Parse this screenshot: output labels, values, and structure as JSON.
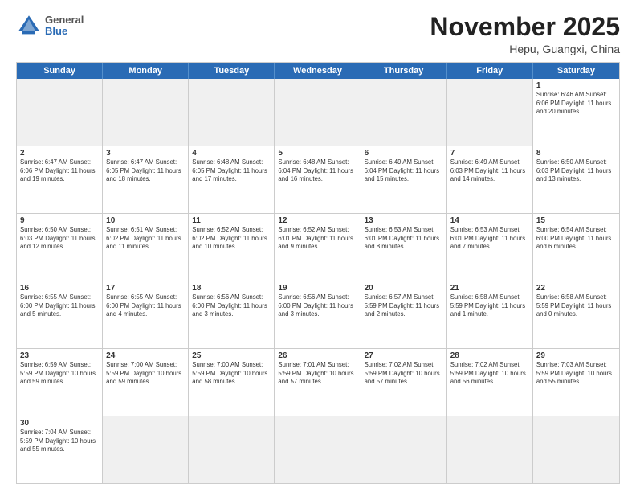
{
  "header": {
    "logo_general": "General",
    "logo_blue": "Blue",
    "month_title": "November 2025",
    "location": "Hepu, Guangxi, China"
  },
  "day_headers": [
    "Sunday",
    "Monday",
    "Tuesday",
    "Wednesday",
    "Thursday",
    "Friday",
    "Saturday"
  ],
  "weeks": [
    [
      {
        "num": "",
        "info": "",
        "empty": true
      },
      {
        "num": "",
        "info": "",
        "empty": true
      },
      {
        "num": "",
        "info": "",
        "empty": true
      },
      {
        "num": "",
        "info": "",
        "empty": true
      },
      {
        "num": "",
        "info": "",
        "empty": true
      },
      {
        "num": "",
        "info": "",
        "empty": true
      },
      {
        "num": "1",
        "info": "Sunrise: 6:46 AM\nSunset: 6:06 PM\nDaylight: 11 hours and 20 minutes.",
        "empty": false
      }
    ],
    [
      {
        "num": "2",
        "info": "Sunrise: 6:47 AM\nSunset: 6:06 PM\nDaylight: 11 hours and 19 minutes.",
        "empty": false
      },
      {
        "num": "3",
        "info": "Sunrise: 6:47 AM\nSunset: 6:05 PM\nDaylight: 11 hours and 18 minutes.",
        "empty": false
      },
      {
        "num": "4",
        "info": "Sunrise: 6:48 AM\nSunset: 6:05 PM\nDaylight: 11 hours and 17 minutes.",
        "empty": false
      },
      {
        "num": "5",
        "info": "Sunrise: 6:48 AM\nSunset: 6:04 PM\nDaylight: 11 hours and 16 minutes.",
        "empty": false
      },
      {
        "num": "6",
        "info": "Sunrise: 6:49 AM\nSunset: 6:04 PM\nDaylight: 11 hours and 15 minutes.",
        "empty": false
      },
      {
        "num": "7",
        "info": "Sunrise: 6:49 AM\nSunset: 6:03 PM\nDaylight: 11 hours and 14 minutes.",
        "empty": false
      },
      {
        "num": "8",
        "info": "Sunrise: 6:50 AM\nSunset: 6:03 PM\nDaylight: 11 hours and 13 minutes.",
        "empty": false
      }
    ],
    [
      {
        "num": "9",
        "info": "Sunrise: 6:50 AM\nSunset: 6:03 PM\nDaylight: 11 hours and 12 minutes.",
        "empty": false
      },
      {
        "num": "10",
        "info": "Sunrise: 6:51 AM\nSunset: 6:02 PM\nDaylight: 11 hours and 11 minutes.",
        "empty": false
      },
      {
        "num": "11",
        "info": "Sunrise: 6:52 AM\nSunset: 6:02 PM\nDaylight: 11 hours and 10 minutes.",
        "empty": false
      },
      {
        "num": "12",
        "info": "Sunrise: 6:52 AM\nSunset: 6:01 PM\nDaylight: 11 hours and 9 minutes.",
        "empty": false
      },
      {
        "num": "13",
        "info": "Sunrise: 6:53 AM\nSunset: 6:01 PM\nDaylight: 11 hours and 8 minutes.",
        "empty": false
      },
      {
        "num": "14",
        "info": "Sunrise: 6:53 AM\nSunset: 6:01 PM\nDaylight: 11 hours and 7 minutes.",
        "empty": false
      },
      {
        "num": "15",
        "info": "Sunrise: 6:54 AM\nSunset: 6:00 PM\nDaylight: 11 hours and 6 minutes.",
        "empty": false
      }
    ],
    [
      {
        "num": "16",
        "info": "Sunrise: 6:55 AM\nSunset: 6:00 PM\nDaylight: 11 hours and 5 minutes.",
        "empty": false
      },
      {
        "num": "17",
        "info": "Sunrise: 6:55 AM\nSunset: 6:00 PM\nDaylight: 11 hours and 4 minutes.",
        "empty": false
      },
      {
        "num": "18",
        "info": "Sunrise: 6:56 AM\nSunset: 6:00 PM\nDaylight: 11 hours and 3 minutes.",
        "empty": false
      },
      {
        "num": "19",
        "info": "Sunrise: 6:56 AM\nSunset: 6:00 PM\nDaylight: 11 hours and 3 minutes.",
        "empty": false
      },
      {
        "num": "20",
        "info": "Sunrise: 6:57 AM\nSunset: 5:59 PM\nDaylight: 11 hours and 2 minutes.",
        "empty": false
      },
      {
        "num": "21",
        "info": "Sunrise: 6:58 AM\nSunset: 5:59 PM\nDaylight: 11 hours and 1 minute.",
        "empty": false
      },
      {
        "num": "22",
        "info": "Sunrise: 6:58 AM\nSunset: 5:59 PM\nDaylight: 11 hours and 0 minutes.",
        "empty": false
      }
    ],
    [
      {
        "num": "23",
        "info": "Sunrise: 6:59 AM\nSunset: 5:59 PM\nDaylight: 10 hours and 59 minutes.",
        "empty": false
      },
      {
        "num": "24",
        "info": "Sunrise: 7:00 AM\nSunset: 5:59 PM\nDaylight: 10 hours and 59 minutes.",
        "empty": false
      },
      {
        "num": "25",
        "info": "Sunrise: 7:00 AM\nSunset: 5:59 PM\nDaylight: 10 hours and 58 minutes.",
        "empty": false
      },
      {
        "num": "26",
        "info": "Sunrise: 7:01 AM\nSunset: 5:59 PM\nDaylight: 10 hours and 57 minutes.",
        "empty": false
      },
      {
        "num": "27",
        "info": "Sunrise: 7:02 AM\nSunset: 5:59 PM\nDaylight: 10 hours and 57 minutes.",
        "empty": false
      },
      {
        "num": "28",
        "info": "Sunrise: 7:02 AM\nSunset: 5:59 PM\nDaylight: 10 hours and 56 minutes.",
        "empty": false
      },
      {
        "num": "29",
        "info": "Sunrise: 7:03 AM\nSunset: 5:59 PM\nDaylight: 10 hours and 55 minutes.",
        "empty": false
      }
    ],
    [
      {
        "num": "30",
        "info": "Sunrise: 7:04 AM\nSunset: 5:59 PM\nDaylight: 10 hours and 55 minutes.",
        "empty": false
      },
      {
        "num": "",
        "info": "",
        "empty": true
      },
      {
        "num": "",
        "info": "",
        "empty": true
      },
      {
        "num": "",
        "info": "",
        "empty": true
      },
      {
        "num": "",
        "info": "",
        "empty": true
      },
      {
        "num": "",
        "info": "",
        "empty": true
      },
      {
        "num": "",
        "info": "",
        "empty": true
      }
    ]
  ]
}
